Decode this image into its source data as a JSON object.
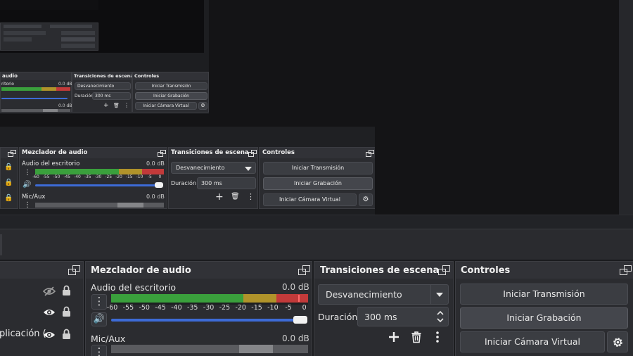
{
  "panels": {
    "mixer": {
      "title": "Mezclador de audio"
    },
    "transitions": {
      "title": "Transiciones de escena"
    },
    "controls": {
      "title": "Controles"
    }
  },
  "audio": {
    "desktop": {
      "name": "Audio del escritorio",
      "level": "0.0 dB"
    },
    "mic": {
      "name": "Mic/Aux",
      "level": "0.0 dB"
    },
    "ticks": [
      "-60",
      "-55",
      "-50",
      "-45",
      "-40",
      "-35",
      "-30",
      "-25",
      "-20",
      "-15",
      "-10",
      "-5",
      "0"
    ],
    "small_ticks": [
      "-60",
      "-55",
      "-50",
      "-45",
      "-40",
      "-35",
      "-30",
      "-25",
      "-20",
      "-15",
      "-10",
      "-5",
      "0"
    ]
  },
  "transitions": {
    "selected": "Desvanecimiento",
    "duration_label": "Duración",
    "duration_value": "300 ms"
  },
  "controls": {
    "start_stream": "Iniciar Transmisión",
    "start_record": "Iniciar Grabación",
    "start_virtual_cam": "Iniciar Cámara Virtual"
  },
  "sources": {
    "partial_label": "plicación ("
  },
  "nested": {
    "mixer_title": "audio",
    "transitions_title": "Transiciones de escena",
    "controls_title": "Controles",
    "desktop_partial": "ritorio",
    "level": "0.0 dB",
    "selected": "Desvanecimiento",
    "duration_label": "Duración",
    "duration_value": "300 ms",
    "start_stream": "Iniciar Transmisión",
    "start_record": "Iniciar Grabación",
    "start_virtual_cam": "Iniciar Cámara Virtual"
  },
  "colors": {
    "accent_slider": "#3d6bd6",
    "meter_green": "#3aa03c",
    "meter_yellow": "#b0932a",
    "meter_red": "#c23a3a"
  }
}
